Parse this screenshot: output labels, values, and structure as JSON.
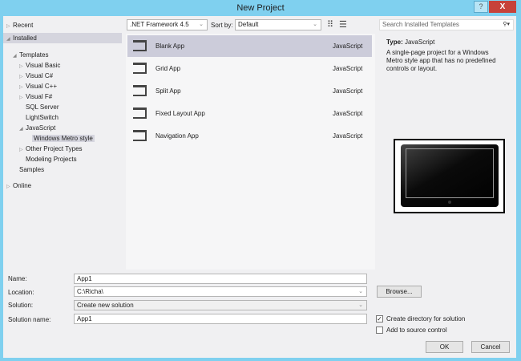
{
  "window": {
    "title": "New Project",
    "help": "?",
    "close": "X"
  },
  "tree": [
    {
      "label": "Recent",
      "arrow": "▷",
      "indent": 0
    },
    {
      "label": "Installed",
      "arrow": "◢",
      "indent": 0,
      "selected": "section"
    },
    {
      "label": "Templates",
      "arrow": "◢",
      "indent": 1
    },
    {
      "label": "Visual Basic",
      "arrow": "▷",
      "indent": 2
    },
    {
      "label": "Visual C#",
      "arrow": "▷",
      "indent": 2
    },
    {
      "label": "Visual C++",
      "arrow": "▷",
      "indent": 2
    },
    {
      "label": "Visual F#",
      "arrow": "▷",
      "indent": 2
    },
    {
      "label": "SQL Server",
      "arrow": "",
      "indent": 2
    },
    {
      "label": "LightSwitch",
      "arrow": "",
      "indent": 2
    },
    {
      "label": "JavaScript",
      "arrow": "◢",
      "indent": 2
    },
    {
      "label": "Windows Metro style",
      "arrow": "",
      "indent": 3,
      "selected": "item"
    },
    {
      "label": "Other Project Types",
      "arrow": "▷",
      "indent": 2
    },
    {
      "label": "Modeling Projects",
      "arrow": "",
      "indent": 2
    },
    {
      "label": "Samples",
      "arrow": "",
      "indent": 1
    },
    {
      "label": "Online",
      "arrow": "▷",
      "indent": 0
    }
  ],
  "toolbar": {
    "framework": ".NET Framework 4.5",
    "sort_label": "Sort by:",
    "sort_value": "Default",
    "search_placeholder": "Search Installed Templates"
  },
  "templates": [
    {
      "name": "Blank App",
      "lang": "JavaScript"
    },
    {
      "name": "Grid App",
      "lang": "JavaScript"
    },
    {
      "name": "Split App",
      "lang": "JavaScript"
    },
    {
      "name": "Fixed Layout App",
      "lang": "JavaScript"
    },
    {
      "name": "Navigation App",
      "lang": "JavaScript"
    }
  ],
  "details": {
    "type_label": "Type:",
    "type_value": "JavaScript",
    "description": "A single-page project for a Windows Metro style app that has no predefined controls or layout."
  },
  "form": {
    "name_label": "Name:",
    "name_value": "App1",
    "location_label": "Location:",
    "location_value": "C:\\Richa\\",
    "solution_label": "Solution:",
    "solution_value": "Create new solution",
    "solution_name_label": "Solution name:",
    "solution_name_value": "App1",
    "browse": "Browse...",
    "create_dir": "Create directory for solution",
    "create_dir_checked": true,
    "source_control": "Add to source control",
    "source_control_checked": false,
    "ok": "OK",
    "cancel": "Cancel"
  }
}
